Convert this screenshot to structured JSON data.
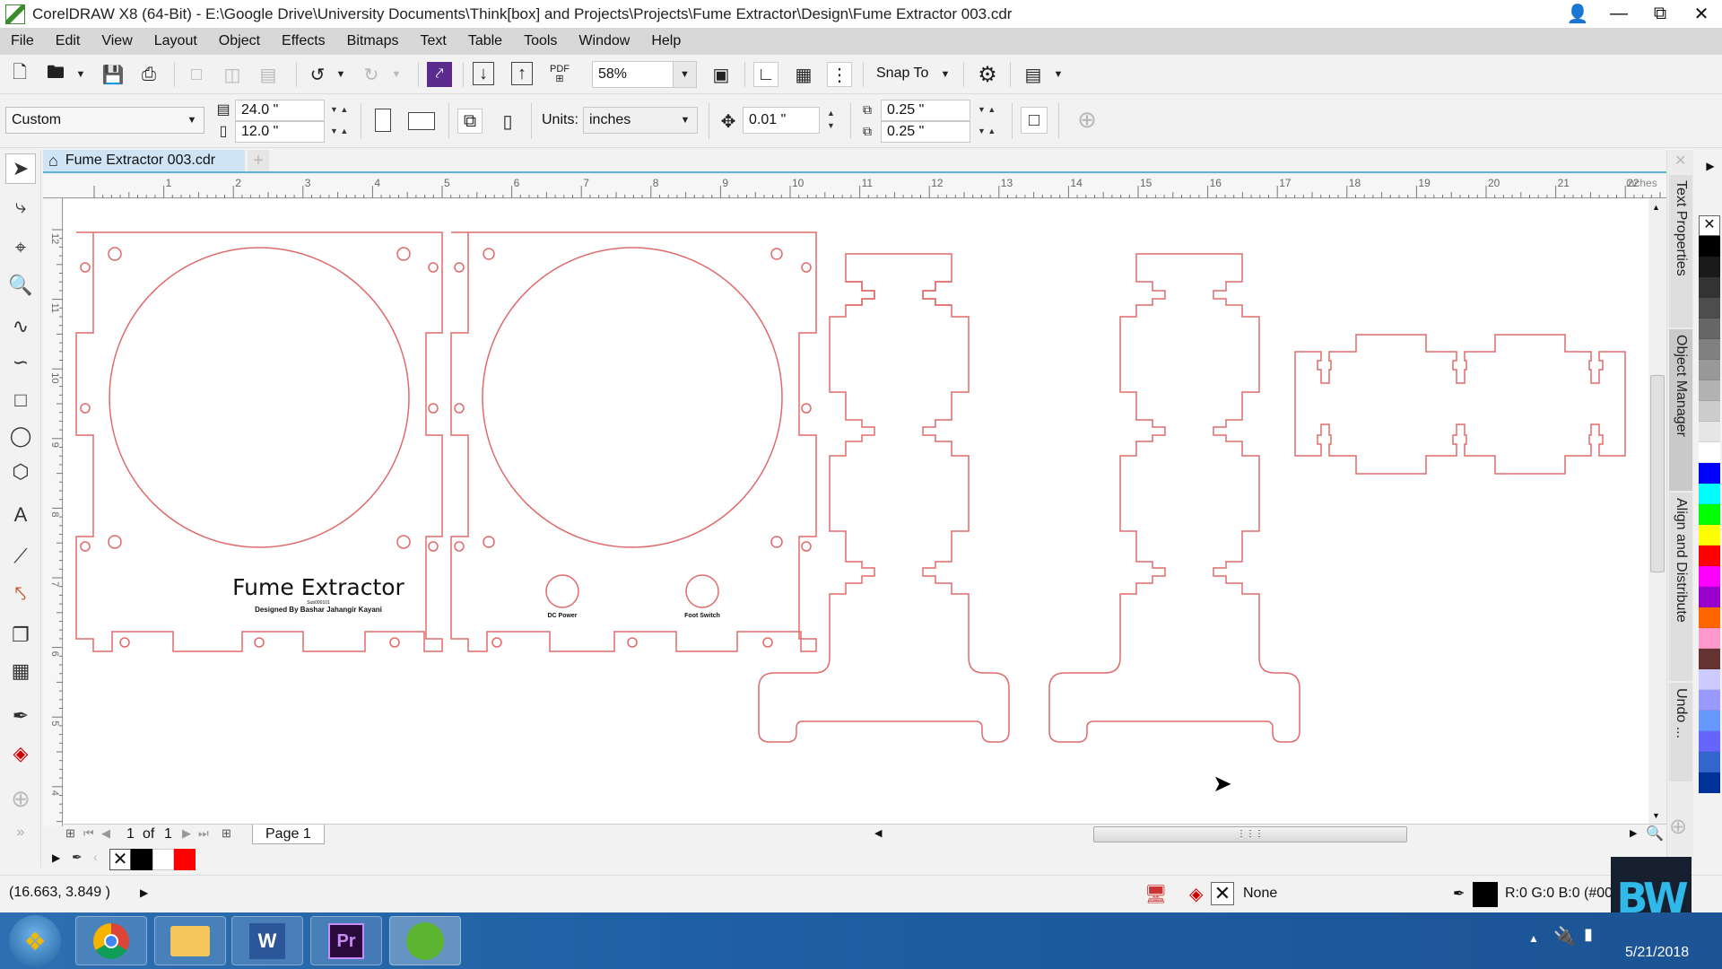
{
  "window": {
    "title": "CorelDRAW X8 (64-Bit) - E:\\Google Drive\\University Documents\\Think[box] and Projects\\Projects\\Fume Extractor\\Design\\Fume Extractor 003.cdr",
    "controls": [
      "user-icon",
      "minimize",
      "restore",
      "close"
    ]
  },
  "menubar": {
    "items": [
      {
        "label": "File",
        "accel": "F"
      },
      {
        "label": "Edit",
        "accel": "E"
      },
      {
        "label": "View",
        "accel": "V"
      },
      {
        "label": "Layout",
        "accel": "L"
      },
      {
        "label": "Object",
        "accel": "j"
      },
      {
        "label": "Effects",
        "accel": "C"
      },
      {
        "label": "Bitmaps",
        "accel": "B"
      },
      {
        "label": "Text",
        "accel": "X"
      },
      {
        "label": "Table",
        "accel": "T"
      },
      {
        "label": "Tools",
        "accel": "o"
      },
      {
        "label": "Window",
        "accel": "W"
      },
      {
        "label": "Help",
        "accel": "H"
      }
    ]
  },
  "standard_toolbar": {
    "zoom_level": "58%",
    "snap_to_label": "Snap To",
    "pdf_label": "PDF"
  },
  "property_bar": {
    "page_size": "Custom",
    "page_width": "24.0 \"",
    "page_height": "12.0 \"",
    "units_label": "Units:",
    "units_value": "inches",
    "nudge": "0.01 \"",
    "duplicate_x": "0.25 \"",
    "duplicate_y": "0.25 \""
  },
  "document": {
    "tab_label": "Fume Extractor 003.cdr",
    "ruler_unit": "inches",
    "h_ruler_ticks": [
      "1",
      "2",
      "3",
      "4",
      "5",
      "6",
      "7",
      "8",
      "9",
      "10",
      "11",
      "12",
      "13",
      "14",
      "15",
      "16",
      "17",
      "18",
      "19",
      "20",
      "21",
      "22"
    ],
    "v_ruler_ticks": [
      "12",
      "11",
      "10",
      "9",
      "8",
      "7",
      "6",
      "5",
      "4"
    ],
    "design_text": {
      "title": "Fume Extractor",
      "subtitle": "Designed By Bashar Jahangir Kayani",
      "small_line": "Sub000101",
      "label_dc_power": "DC Power",
      "label_foot_switch": "Foot Switch"
    },
    "outline_color": "#e06a6a"
  },
  "page_nav": {
    "current": "1",
    "of_label": "of",
    "total": "1",
    "page_tab": "Page 1"
  },
  "doc_palette": [
    "none",
    "#000000",
    "#ffffff",
    "#ff0000"
  ],
  "status": {
    "cursor_coords": "(16.663, 3.849 )",
    "fill_label": "None",
    "outline_label": "R:0 G:0 B:0 (#000"
  },
  "dockers": [
    "Text Properties",
    "Object Manager",
    "Align and Distribute",
    "Undo ..."
  ],
  "color_palette": [
    "none",
    "#000000",
    "#1a1a1a",
    "#333333",
    "#4d4d4d",
    "#666666",
    "#808080",
    "#999999",
    "#b3b3b3",
    "#cccccc",
    "#e6e6e6",
    "#ffffff",
    "#0000ff",
    "#00ffff",
    "#00ff00",
    "#ffff00",
    "#ff0000",
    "#ff00ff",
    "#9900cc",
    "#ff6600",
    "#ff99cc",
    "#663333",
    "#ccccff",
    "#9999ff",
    "#6699ff",
    "#6666ff",
    "#3366cc",
    "#003399"
  ],
  "taskbar": {
    "apps": [
      "Start",
      "Chrome",
      "File Explorer",
      "Word",
      "Premiere Pro",
      "CorelDRAW"
    ],
    "date": "5/21/2018"
  },
  "watermark": "BW"
}
